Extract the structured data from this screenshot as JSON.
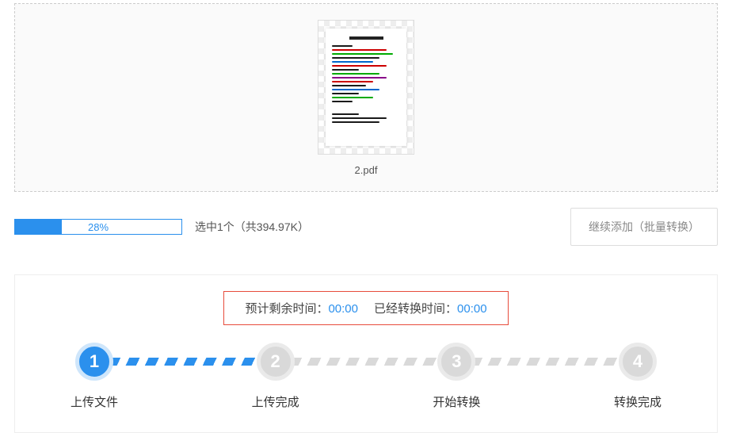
{
  "file": {
    "name": "2.pdf"
  },
  "progress": {
    "percent": 28,
    "label": "28%"
  },
  "selected_info": "选中1个（共394.97K）",
  "add_more_label": "继续添加（批量转换）",
  "time": {
    "remaining_label": "预计剩余时间：",
    "remaining_value": "00:00",
    "elapsed_label": "已经转换时间：",
    "elapsed_value": "00:00"
  },
  "steps": [
    {
      "num": "1",
      "label": "上传文件",
      "active": true
    },
    {
      "num": "2",
      "label": "上传完成",
      "active": false
    },
    {
      "num": "3",
      "label": "开始转换",
      "active": false
    },
    {
      "num": "4",
      "label": "转换完成",
      "active": false
    }
  ]
}
